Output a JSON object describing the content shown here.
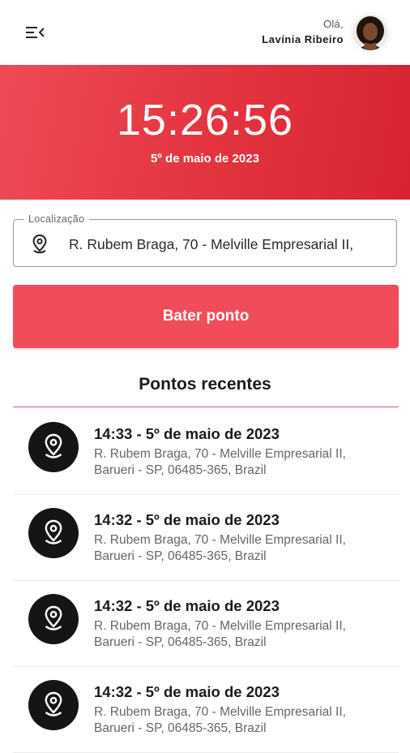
{
  "header": {
    "greeting": "Olá,",
    "user_name": "Lavínia Ribeiro",
    "menu_icon": "menu-collapse-icon",
    "avatar_icon": "user-avatar"
  },
  "clock": {
    "time": "15:26:56",
    "date": "5º de maio de 2023"
  },
  "location_field": {
    "label": "Localização",
    "value": "R. Rubem Braga, 70 - Melville Empresarial II,",
    "icon": "location-pin-icon"
  },
  "punch_button": {
    "label": "Bater ponto"
  },
  "recent": {
    "title": "Pontos recentes",
    "items": [
      {
        "when": "14:33 - 5º de maio de 2023",
        "address": "R. Rubem Braga, 70 - Melville Empresarial II, Barueri - SP, 06485-365, Brazil"
      },
      {
        "when": "14:32 - 5º de maio de 2023",
        "address": "R. Rubem Braga, 70 - Melville Empresarial II, Barueri - SP, 06485-365, Brazil"
      },
      {
        "when": "14:32 - 5º de maio de 2023",
        "address": "R. Rubem Braga, 70 - Melville Empresarial II, Barueri - SP, 06485-365, Brazil"
      },
      {
        "when": "14:32 - 5º de maio de 2023",
        "address": "R. Rubem Braga, 70 - Melville Empresarial II, Barueri - SP, 06485-365, Brazil"
      }
    ]
  },
  "colors": {
    "accent": "#e3333f",
    "button": "#f14c5a",
    "icon_circle": "#151515"
  }
}
